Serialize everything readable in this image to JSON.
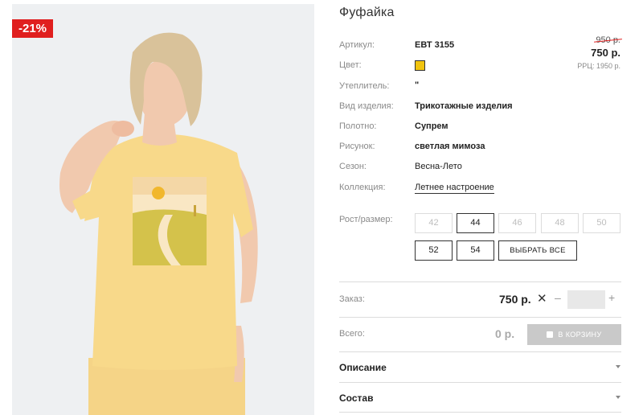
{
  "product": {
    "discount_badge": "-21%",
    "title": "Фуфайка",
    "attributes": [
      {
        "label": "Артикул:",
        "value": "ЕВТ 3155"
      },
      {
        "label": "Цвет:",
        "value": ""
      },
      {
        "label": "Утеплитель:",
        "value": "\""
      },
      {
        "label": "Вид изделия:",
        "value": "Трикотажные изделия"
      },
      {
        "label": "Полотно:",
        "value": "Супрем"
      },
      {
        "label": "Рисунок:",
        "value": "светлая мимоза"
      },
      {
        "label": "Сезон:",
        "value": "Весна-Лето"
      },
      {
        "label": "Коллекция:",
        "value": "Летнее настроение"
      }
    ],
    "color_swatch": "#f1c40f",
    "old_price": "950 р.",
    "new_price": "750 р.",
    "rrp": "РРЦ: 1950 р."
  },
  "sizes": {
    "label": "Рост/размер:",
    "options": [
      {
        "label": "42",
        "available": false
      },
      {
        "label": "44",
        "available": true
      },
      {
        "label": "46",
        "available": false
      },
      {
        "label": "48",
        "available": false
      },
      {
        "label": "50",
        "available": false
      },
      {
        "label": "52",
        "available": true
      },
      {
        "label": "54",
        "available": true
      }
    ],
    "select_all": "ВЫБРАТЬ ВСЕ"
  },
  "order": {
    "label": "Заказ:",
    "price": "750 р.",
    "times": "✕",
    "minus": "–",
    "plus": "+",
    "quantity": ""
  },
  "total": {
    "label": "Всего:",
    "value": "0 р.",
    "cart_button": "В КОРЗИНУ"
  },
  "accordion": [
    {
      "title": "Описание"
    },
    {
      "title": "Состав"
    }
  ],
  "colors": {
    "badge": "#e01f1f",
    "tshirt": "#f8d98a",
    "hair": "#d9c29a"
  }
}
